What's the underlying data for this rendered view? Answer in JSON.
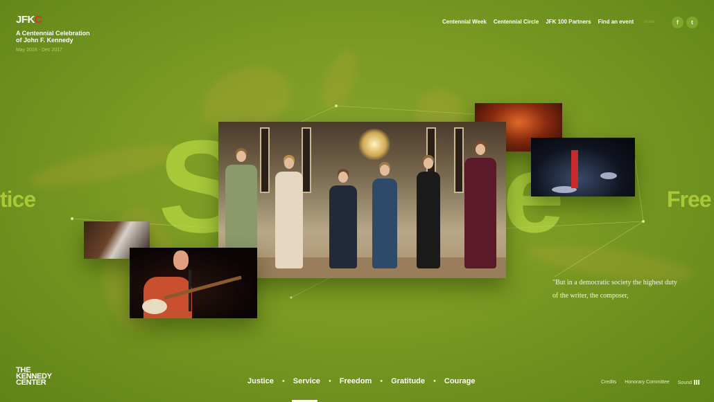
{
  "header": {
    "logo_text": "JFK",
    "logo_accent": "C",
    "tagline": "A Centennial Celebration of John F. Kennedy",
    "dates": "May 2016 - Dec 2017"
  },
  "topnav": {
    "items": [
      "Centennial Week",
      "Centennial Circle",
      "JFK 100 Partners",
      "Find an event"
    ],
    "social_faint": "share",
    "facebook_icon": "f",
    "twitter_icon": "t"
  },
  "hero": {
    "big_word_left": "S",
    "big_word_right": "e",
    "side_word_left": "tice",
    "side_word_right": "Free"
  },
  "quote": {
    "text": "\"But in a democratic society the highest duty of the writer, the composer,"
  },
  "footer": {
    "logo_lines": [
      "THE",
      "KENNEDY",
      "CENTER"
    ],
    "values_nav": [
      "Justice",
      "Service",
      "Freedom",
      "Gratitude",
      "Courage"
    ],
    "dot": "•",
    "links": [
      "Credits",
      "Honorary Committee",
      "Sound"
    ]
  },
  "colors": {
    "background": "#7a9a22",
    "accent_word": "#a8c83a",
    "logo_accent": "#d8322b"
  }
}
